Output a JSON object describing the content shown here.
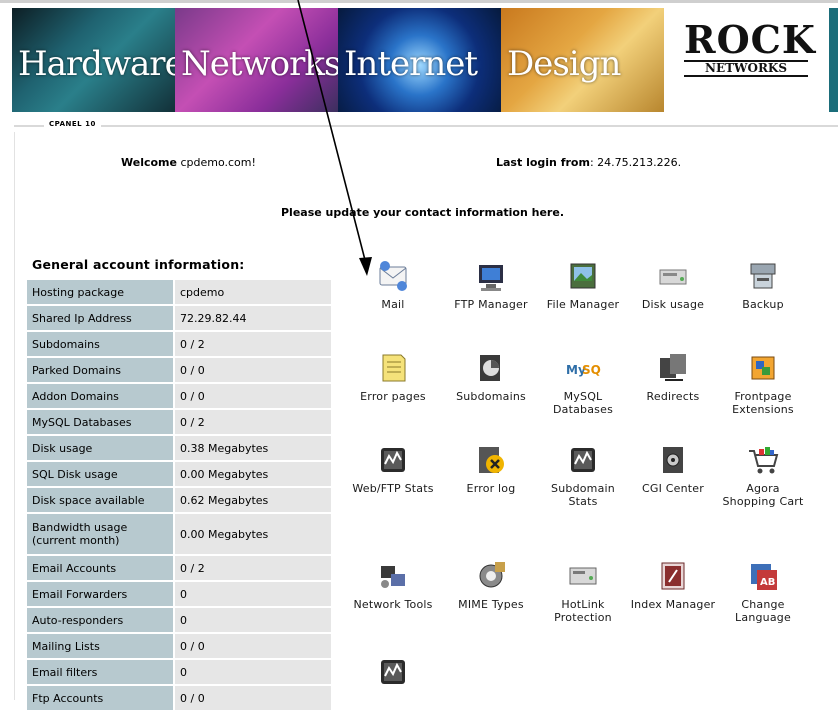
{
  "banner": {
    "panels": [
      "Hardware",
      "Networks",
      "Internet",
      "Design"
    ],
    "logo_main": "ROCK",
    "logo_sub": "NETWORKS"
  },
  "cpanel_label": "CPANEL 10",
  "welcome": {
    "label": "Welcome",
    "value": "cpdemo.com!"
  },
  "last_login": {
    "label": "Last login from",
    "value": ": 24.75.213.226."
  },
  "update_notice": {
    "text": "Please update your contact information ",
    "link": "here",
    "suffix": "."
  },
  "general_info": {
    "title": "General account information:",
    "rows": [
      {
        "key": "Hosting package",
        "value": "cpdemo"
      },
      {
        "key": "Shared Ip Address",
        "value": "72.29.82.44"
      },
      {
        "key": "Subdomains",
        "value": "0 / 2"
      },
      {
        "key": "Parked Domains",
        "value": "0 / 0"
      },
      {
        "key": "Addon Domains",
        "value": "0 / 0"
      },
      {
        "key": "MySQL Databases",
        "value": "0 / 2"
      },
      {
        "key": "Disk usage",
        "value": "0.38 Megabytes"
      },
      {
        "key": "SQL Disk usage",
        "value": "0.00 Megabytes"
      },
      {
        "key": "Disk space available",
        "value": "0.62 Megabytes"
      },
      {
        "key": "Bandwidth usage (current month)",
        "value": "0.00 Megabytes"
      },
      {
        "key": "Email Accounts",
        "value": "0 / 2"
      },
      {
        "key": "Email Forwarders",
        "value": "0"
      },
      {
        "key": "Auto-responders",
        "value": "0"
      },
      {
        "key": "Mailing Lists",
        "value": "0 / 0"
      },
      {
        "key": "Email filters",
        "value": "0"
      },
      {
        "key": "Ftp Accounts",
        "value": "0 / 0"
      }
    ]
  },
  "icons": [
    {
      "label": "Mail",
      "icon": "mail-icon"
    },
    {
      "label": "FTP Manager",
      "icon": "ftp-manager-icon"
    },
    {
      "label": "File Manager",
      "icon": "file-manager-icon"
    },
    {
      "label": "Disk usage",
      "icon": "disk-usage-icon"
    },
    {
      "label": "Backup",
      "icon": "backup-icon"
    },
    {
      "label": "Error pages",
      "icon": "error-pages-icon"
    },
    {
      "label": "Subdomains",
      "icon": "subdomains-icon"
    },
    {
      "label": "MySQL Databases",
      "icon": "mysql-icon"
    },
    {
      "label": "Redirects",
      "icon": "redirects-icon"
    },
    {
      "label": "Frontpage Extensions",
      "icon": "frontpage-icon"
    },
    {
      "label": "Web/FTP Stats",
      "icon": "stats-icon"
    },
    {
      "label": "Error log",
      "icon": "error-log-icon"
    },
    {
      "label": "Subdomain Stats",
      "icon": "subdomain-stats-icon"
    },
    {
      "label": "CGI Center",
      "icon": "cgi-center-icon"
    },
    {
      "label": "Agora Shopping Cart",
      "icon": "shopping-cart-icon"
    },
    {
      "label": "Network Tools",
      "icon": "network-tools-icon"
    },
    {
      "label": "MIME Types",
      "icon": "mime-types-icon"
    },
    {
      "label": "HotLink Protection",
      "icon": "hotlink-icon"
    },
    {
      "label": "Index Manager",
      "icon": "index-manager-icon"
    },
    {
      "label": "Change Language",
      "icon": "change-language-icon"
    },
    {
      "label": "",
      "icon": "stats-icon"
    }
  ]
}
